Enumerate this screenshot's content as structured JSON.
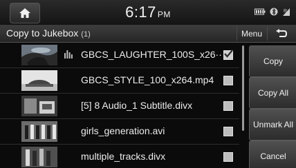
{
  "status_bar": {
    "clock_time": "6:17",
    "clock_ampm": "PM",
    "icons": [
      "home-icon",
      "battery-icon",
      "bluetooth-icon",
      "signal-icon"
    ]
  },
  "header": {
    "title": "Copy to Jukebox",
    "count": "(1)",
    "menu_label": "Menu",
    "back_icon": "back-arrow-icon"
  },
  "file_list": [
    {
      "name": "GBCS_LAUGHTER_100S_x26···",
      "checked": true,
      "playing": true
    },
    {
      "name": "GBCS_STYLE_100_x264.mp4",
      "checked": false,
      "playing": false
    },
    {
      "name": "[5] 8 Audio_1 Subtitle.divx",
      "checked": false,
      "playing": false
    },
    {
      "name": "girls_generation.avi",
      "checked": false,
      "playing": false
    },
    {
      "name": "multiple_tracks.divx",
      "checked": false,
      "playing": false
    }
  ],
  "actions": {
    "copy": "Copy",
    "copy_all": "Copy All",
    "unmark_all": "Unmark All",
    "cancel": "Cancel"
  }
}
